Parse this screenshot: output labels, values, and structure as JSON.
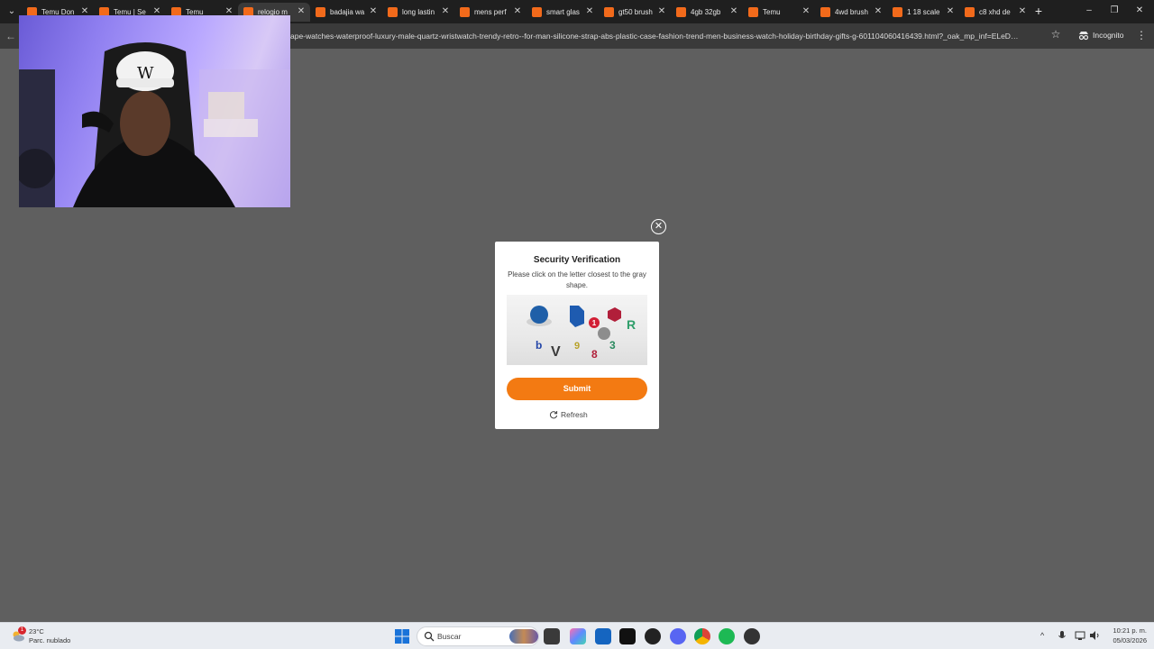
{
  "browser": {
    "tabs": [
      {
        "title": "Temu Don",
        "active": false
      },
      {
        "title": "Temu | Se",
        "active": false
      },
      {
        "title": "Temu",
        "active": false
      },
      {
        "title": "relogio m",
        "active": true
      },
      {
        "title": "badajia wa",
        "active": false
      },
      {
        "title": "long lastin",
        "active": false
      },
      {
        "title": "mens perf",
        "active": false
      },
      {
        "title": "smart glas",
        "active": false
      },
      {
        "title": "gt50 brush",
        "active": false
      },
      {
        "title": "4gb 32gb",
        "active": false
      },
      {
        "title": "Temu",
        "active": false
      },
      {
        "title": "4wd brush",
        "active": false
      },
      {
        "title": "1 18 scale",
        "active": false
      },
      {
        "title": "c8 xhd de",
        "active": false
      }
    ],
    "close_glyph": "✕",
    "new_tab_glyph": "+",
    "url": "ape-watches-waterproof-luxury-male-quartz-wristwatch-trendy-retro--for-man-silicone-strap-abs-plastic-case-fashion-trend-men-business-watch-holiday-birthday-gifts-g-601104060416439.html?_oak_mp_inf=ELeD…",
    "incognito_label": "Incognito",
    "back_glyph": "←",
    "star_glyph": "☆",
    "menu_glyph": "⋮",
    "tab_menu_glyph": "⌄",
    "window_controls": [
      "–",
      "❐",
      "✕"
    ]
  },
  "captcha_modal": {
    "title": "Security Verification",
    "instruction": "Please click on the letter closest to the gray shape.",
    "letters": [
      "1",
      "R",
      "3",
      "b",
      "V",
      "9",
      "8"
    ],
    "submit_label": "Submit",
    "refresh_label": "Refresh",
    "close_glyph": "✕",
    "accent_color": "#f37a12"
  },
  "taskbar": {
    "weather_temp": "23°C",
    "weather_desc": "Parc. nublado",
    "weather_badge": "1",
    "search_placeholder": "Buscar",
    "tray_chevron": "^",
    "clock_time": "10:21 p. m.",
    "clock_date": "05/03/2026"
  }
}
